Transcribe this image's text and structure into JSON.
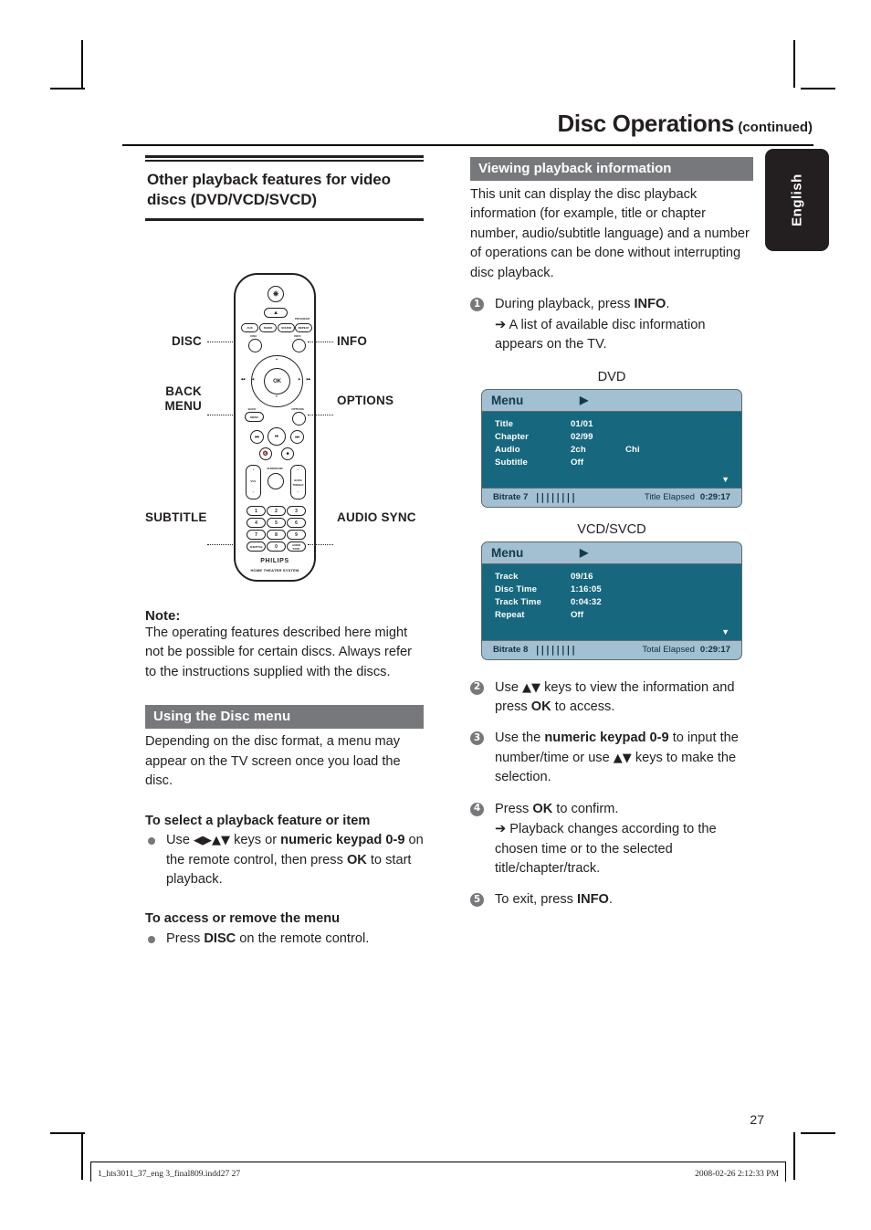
{
  "header": {
    "title": "Disc Operations",
    "continued": "(continued)",
    "language_tab": "English"
  },
  "left": {
    "section_heading": "Other playback features for video discs (DVD/VCD/SVCD)",
    "remote": {
      "power_icon": "power-icon",
      "eject_icon": "eject-icon",
      "top_buttons": [
        "AUX",
        "RADIO",
        "SOUND",
        "REPEAT"
      ],
      "program_label": "PROGRAM",
      "disc_button": "DISC",
      "info_button": "INFO",
      "ok_button": "OK",
      "back_button": "MENU",
      "back_label": "BACK",
      "options_button": "OPTIONS",
      "volume_label": "VOL",
      "surround_label": "SURROUND",
      "bass_label": "BASS",
      "treble_label": "TREBLE",
      "subtitle_button": "SUBTITLE",
      "audio_sync_button": "AUDIO SYNC",
      "keypad": [
        "1",
        "2",
        "3",
        "4",
        "5",
        "6",
        "7",
        "8",
        "9",
        "0"
      ],
      "brand": "PHILIPS",
      "product": "HOME THEATER SYSTEM"
    },
    "callouts": {
      "disc": "DISC",
      "info": "INFO",
      "back": "BACK",
      "menu": "MENU",
      "options": "OPTIONS",
      "subtitle": "SUBTITLE",
      "audio_sync": "AUDIO SYNC"
    },
    "note": {
      "heading": "Note:",
      "text": "The operating features described here might not be possible for certain discs. Always refer to the instructions supplied with the discs."
    },
    "disc_menu": {
      "band": "Using the Disc menu",
      "intro": "Depending on the disc format, a menu may appear on the TV screen once you load the disc.",
      "sub1_heading": "To select a playback feature or item",
      "sub1_pre": "Use ",
      "sub1_arrows": "◀▶▲▼",
      "sub1_mid": " keys or ",
      "sub1_bold": "numeric keypad 0-9",
      "sub1_post": " on the remote control, then press ",
      "sub1_ok": "OK",
      "sub1_end": " to start playback.",
      "sub2_heading": "To access or remove the menu",
      "sub2_pre": "Press ",
      "sub2_bold": "DISC",
      "sub2_post": " on the remote control."
    }
  },
  "right": {
    "band": "Viewing playback information",
    "intro": "This unit can display the disc playback information (for example, title or chapter number, audio/subtitle language) and a number of operations can be done without interrupting disc playback.",
    "steps": [
      {
        "num": "1",
        "pre": "During playback, press ",
        "bold": "INFO",
        "post": ".",
        "arrow": "➔",
        "result": "A list of available disc information appears on the TV."
      },
      {
        "num": "2",
        "pre": "Use ",
        "bold": "▲▼",
        "post": " keys to view the information and press ",
        "bold2": "OK",
        "post2": " to access.",
        "arrow": "",
        "result": ""
      },
      {
        "num": "3",
        "pre": "Use the ",
        "bold": "numeric keypad 0-9",
        "post": " to input the number/time or use ",
        "bold2": "▲▼",
        "post2": " keys to make the selection.",
        "arrow": "",
        "result": ""
      },
      {
        "num": "4",
        "pre": "Press ",
        "bold": "OK",
        "post": " to confirm.",
        "arrow": "➔",
        "result": "Playback changes according to the chosen time or to the selected title/chapter/track."
      },
      {
        "num": "5",
        "pre": "To exit, press ",
        "bold": "INFO",
        "post": ".",
        "arrow": "",
        "result": ""
      }
    ],
    "osd_dvd": {
      "caption": "DVD",
      "menu_label": "Menu",
      "play_icon": "play-triangle-icon",
      "rows": [
        {
          "key": "Title",
          "value": "01/01",
          "value2": ""
        },
        {
          "key": "Chapter",
          "value": "02/99",
          "value2": ""
        },
        {
          "key": "Audio",
          "value": "2ch",
          "value2": "Chi"
        },
        {
          "key": "Subtitle",
          "value": "Off",
          "value2": ""
        }
      ],
      "scroll_icon": "chevron-down-icon",
      "bitrate_label": "Bitrate 7",
      "bitrate_bars": "||||||||",
      "elapsed_label": "Title Elapsed",
      "elapsed_time": "0:29:17"
    },
    "osd_vcd": {
      "caption": "VCD/SVCD",
      "menu_label": "Menu",
      "play_icon": "play-triangle-icon",
      "rows": [
        {
          "key": "Track",
          "value": "09/16",
          "value2": ""
        },
        {
          "key": "Disc Time",
          "value": "1:16:05",
          "value2": ""
        },
        {
          "key": "Track Time",
          "value": "0:04:32",
          "value2": ""
        },
        {
          "key": "Repeat",
          "value": "Off",
          "value2": ""
        }
      ],
      "scroll_icon": "chevron-down-icon",
      "bitrate_label": "Bitrate 8",
      "bitrate_bars": "||||||||",
      "elapsed_label": "Total Elapsed",
      "elapsed_time": "0:29:17"
    }
  },
  "footer": {
    "page_number": "27",
    "file_name": "1_hts3011_37_eng 3_final809.indd27   27",
    "timestamp": "2008-02-26   2:12:33 PM"
  }
}
